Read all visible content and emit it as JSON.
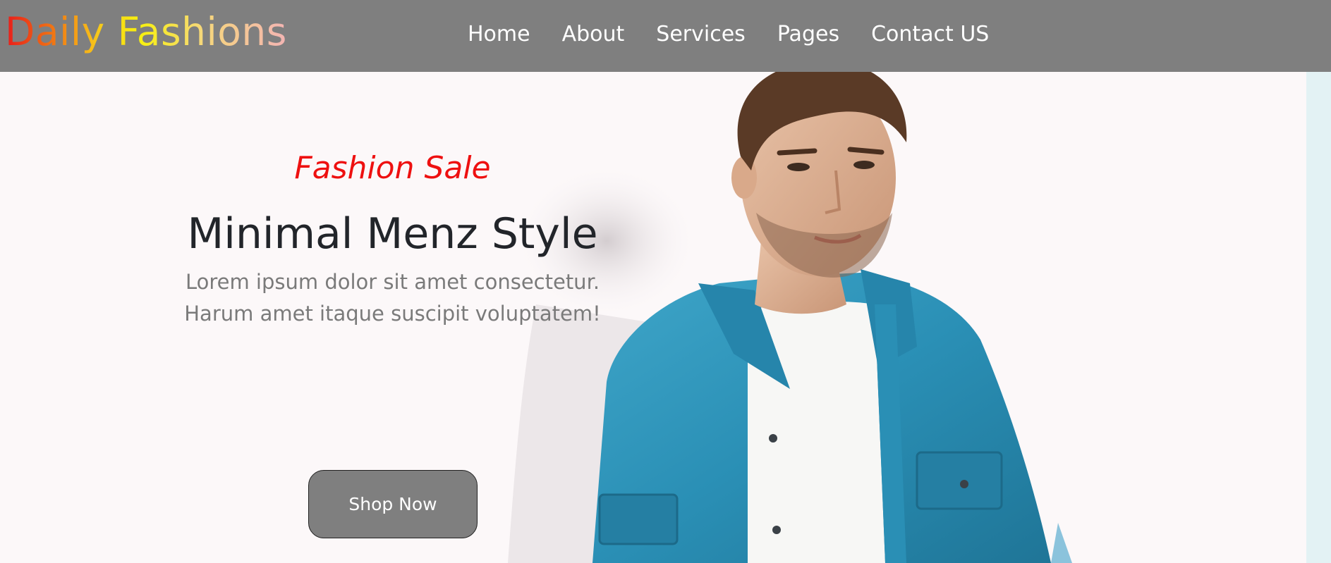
{
  "brand": {
    "name": "Daily Fashions"
  },
  "nav": {
    "items": [
      {
        "label": "Home"
      },
      {
        "label": "About"
      },
      {
        "label": "Services"
      },
      {
        "label": "Pages"
      },
      {
        "label": "Contact US"
      }
    ]
  },
  "hero": {
    "kicker": "Fashion Sale",
    "headline": "Minimal Menz Style",
    "description": "Lorem ipsum dolor sit amet consectetur. Harum amet itaque suscipit voluptatem!",
    "cta_label": "Shop Now",
    "image_icon": "male-model-denim-shirt-photo"
  },
  "colors": {
    "navbar_bg": "#7f7f7f",
    "kicker": "#ee1010",
    "headline": "#22252a",
    "description": "#7a7a7a",
    "button_bg": "#7f7f7f",
    "hero_bg": "#fcf8f9",
    "denim": "#2a8fb5"
  }
}
